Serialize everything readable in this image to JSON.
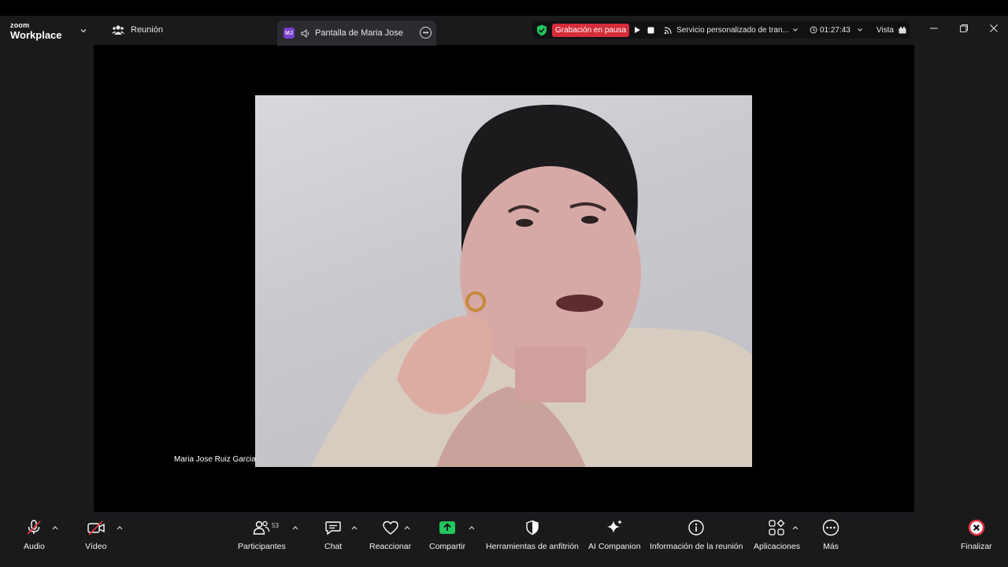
{
  "app": {
    "brand_small": "zoom",
    "brand_big": "Workplace"
  },
  "meeting": {
    "label": "Reunión"
  },
  "share": {
    "initials": "MJ",
    "label": "Pantalla de Maria  Jose"
  },
  "status": {
    "recording": "Grabación en pausa",
    "transcription": "Servicio personalizado de tran...",
    "timer": "01:27:43",
    "view": "Vista"
  },
  "participant": {
    "name": "Maria Jose Ruiz Garcia"
  },
  "toolbar": {
    "audio": "Audio",
    "video": "Vídeo",
    "participants": "Participantes",
    "participants_count": "53",
    "chat": "Chat",
    "react": "Reaccionar",
    "share": "Compartir",
    "host_tools": "Herramientas de anfitrión",
    "ai_companion": "AI Companion",
    "meeting_info": "Información de la reunión",
    "apps": "Aplicaciones",
    "more": "Más",
    "end": "Finalizar"
  },
  "colors": {
    "recording": "#d52c3a",
    "share_green": "#23c55e",
    "end_red": "#e0353f",
    "bar_bg": "#1a1a1d"
  }
}
